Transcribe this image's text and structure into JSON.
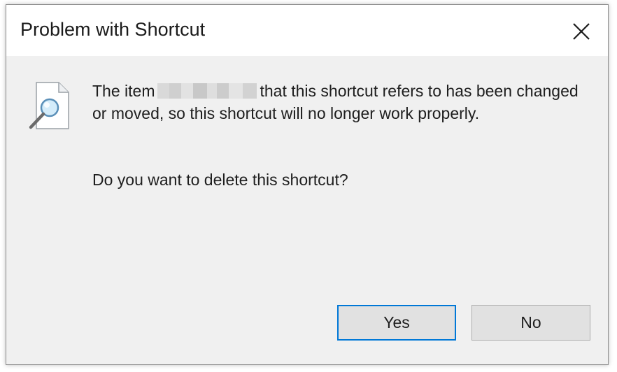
{
  "dialog": {
    "title": "Problem with Shortcut",
    "message_before": "The item",
    "message_after": "that this shortcut refers to has been changed or moved, so this shortcut will no longer work properly.",
    "question": "Do you want to delete this shortcut?",
    "yes_label": "Yes",
    "no_label": "No"
  },
  "icons": {
    "close": "close-icon",
    "document_search": "document-search-icon"
  },
  "colors": {
    "accent": "#0078d7",
    "titlebar": "#ffffff",
    "body": "#f0f0f0"
  }
}
